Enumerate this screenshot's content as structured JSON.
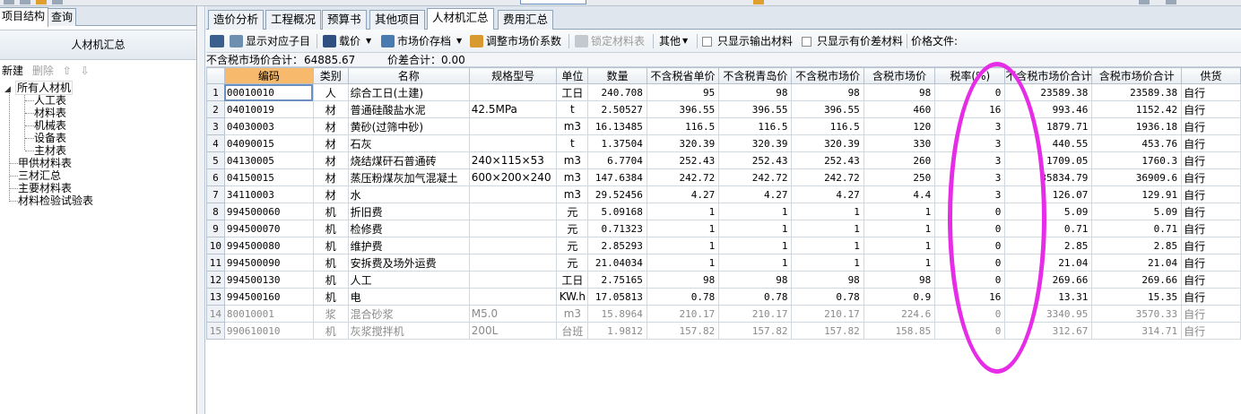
{
  "left": {
    "tabs": [
      "项目结构",
      "查询"
    ],
    "header": "人材机汇总",
    "toolbar": {
      "new": "新建",
      "delete": "删除",
      "up": "⇧",
      "down": "⇩"
    },
    "tree": {
      "root": "所有人材机",
      "children": [
        "人工表",
        "材料表",
        "机械表",
        "设备表",
        "主材表"
      ],
      "others": [
        "甲供材料表",
        "三材汇总",
        "主要材料表",
        "材料检验试验表"
      ]
    }
  },
  "main": {
    "tabs": [
      "造价分析",
      "工程概况",
      "预算书",
      "其他项目",
      "人材机汇总",
      "费用汇总"
    ],
    "active_tab": "人材机汇总",
    "toolbar": {
      "show_sub": "显示对应子目",
      "price_load": "载价",
      "market_archive": "市场价存档",
      "adjust_coeff": "调整市场价系数",
      "lock": "锁定材料表",
      "other": "其他",
      "only_output": "只显示输出材料",
      "only_diff": "只显示有价差材料",
      "price_file": "价格文件:"
    },
    "summary": {
      "total_label": "不含税市场价合计：",
      "total_value": "64885.67",
      "diff_label": "价差合计：",
      "diff_value": "0.00"
    }
  },
  "table": {
    "headers": [
      "编码",
      "类别",
      "名称",
      "规格型号",
      "单位",
      "数量",
      "不含税省单价",
      "不含税青岛价",
      "不含税市场价",
      "含税市场价",
      "税率(%)",
      "不含税市场价合计",
      "含税市场价合计",
      "供货"
    ],
    "rows": [
      {
        "n": "1",
        "code": "00010010",
        "cat": "人",
        "name": "综合工日(土建)",
        "spec": "",
        "unit": "工日",
        "qty": "240.708",
        "p1": "95",
        "p2": "98",
        "p3": "98",
        "p4": "98",
        "tax": "0",
        "t1": "23589.38",
        "t2": "23589.38",
        "sup": "自行",
        "grey": false
      },
      {
        "n": "2",
        "code": "04010019",
        "cat": "材",
        "name": "普通硅酸盐水泥",
        "spec": "42.5MPa",
        "unit": "t",
        "qty": "2.50527",
        "p1": "396.55",
        "p2": "396.55",
        "p3": "396.55",
        "p4": "460",
        "tax": "16",
        "t1": "993.46",
        "t2": "1152.42",
        "sup": "自行",
        "grey": false
      },
      {
        "n": "3",
        "code": "04030003",
        "cat": "材",
        "name": "黄砂(过筛中砂)",
        "spec": "",
        "unit": "m3",
        "qty": "16.13485",
        "p1": "116.5",
        "p2": "116.5",
        "p3": "116.5",
        "p4": "120",
        "tax": "3",
        "t1": "1879.71",
        "t2": "1936.18",
        "sup": "自行",
        "grey": false
      },
      {
        "n": "4",
        "code": "04090015",
        "cat": "材",
        "name": "石灰",
        "spec": "",
        "unit": "t",
        "qty": "1.37504",
        "p1": "320.39",
        "p2": "320.39",
        "p3": "320.39",
        "p4": "330",
        "tax": "3",
        "t1": "440.55",
        "t2": "453.76",
        "sup": "自行",
        "grey": false
      },
      {
        "n": "5",
        "code": "04130005",
        "cat": "材",
        "name": "烧结煤矸石普通砖",
        "spec": "240×115×53",
        "unit": "m3",
        "qty": "6.7704",
        "p1": "252.43",
        "p2": "252.43",
        "p3": "252.43",
        "p4": "260",
        "tax": "3",
        "t1": "1709.05",
        "t2": "1760.3",
        "sup": "自行",
        "grey": false
      },
      {
        "n": "6",
        "code": "04150015",
        "cat": "材",
        "name": "蒸压粉煤灰加气混凝土",
        "spec": "600×200×240",
        "unit": "m3",
        "qty": "147.6384",
        "p1": "242.72",
        "p2": "242.72",
        "p3": "242.72",
        "p4": "250",
        "tax": "3",
        "t1": "35834.79",
        "t2": "36909.6",
        "sup": "自行",
        "grey": false
      },
      {
        "n": "7",
        "code": "34110003",
        "cat": "材",
        "name": "水",
        "spec": "",
        "unit": "m3",
        "qty": "29.52456",
        "p1": "4.27",
        "p2": "4.27",
        "p3": "4.27",
        "p4": "4.4",
        "tax": "3",
        "t1": "126.07",
        "t2": "129.91",
        "sup": "自行",
        "grey": false
      },
      {
        "n": "8",
        "code": "994500060",
        "cat": "机",
        "name": "折旧费",
        "spec": "",
        "unit": "元",
        "qty": "5.09168",
        "p1": "1",
        "p2": "1",
        "p3": "1",
        "p4": "1",
        "tax": "0",
        "t1": "5.09",
        "t2": "5.09",
        "sup": "自行",
        "grey": false
      },
      {
        "n": "9",
        "code": "994500070",
        "cat": "机",
        "name": "检修费",
        "spec": "",
        "unit": "元",
        "qty": "0.71323",
        "p1": "1",
        "p2": "1",
        "p3": "1",
        "p4": "1",
        "tax": "0",
        "t1": "0.71",
        "t2": "0.71",
        "sup": "自行",
        "grey": false
      },
      {
        "n": "10",
        "code": "994500080",
        "cat": "机",
        "name": "维护费",
        "spec": "",
        "unit": "元",
        "qty": "2.85293",
        "p1": "1",
        "p2": "1",
        "p3": "1",
        "p4": "1",
        "tax": "0",
        "t1": "2.85",
        "t2": "2.85",
        "sup": "自行",
        "grey": false
      },
      {
        "n": "11",
        "code": "994500090",
        "cat": "机",
        "name": "安拆费及场外运费",
        "spec": "",
        "unit": "元",
        "qty": "21.04034",
        "p1": "1",
        "p2": "1",
        "p3": "1",
        "p4": "1",
        "tax": "0",
        "t1": "21.04",
        "t2": "21.04",
        "sup": "自行",
        "grey": false
      },
      {
        "n": "12",
        "code": "994500130",
        "cat": "机",
        "name": "人工",
        "spec": "",
        "unit": "工日",
        "qty": "2.75165",
        "p1": "98",
        "p2": "98",
        "p3": "98",
        "p4": "98",
        "tax": "0",
        "t1": "269.66",
        "t2": "269.66",
        "sup": "自行",
        "grey": false
      },
      {
        "n": "13",
        "code": "994500160",
        "cat": "机",
        "name": "电",
        "spec": "",
        "unit": "KW.h",
        "qty": "17.05813",
        "p1": "0.78",
        "p2": "0.78",
        "p3": "0.78",
        "p4": "0.9",
        "tax": "16",
        "t1": "13.31",
        "t2": "15.35",
        "sup": "自行",
        "grey": false
      },
      {
        "n": "14",
        "code": "80010001",
        "cat": "浆",
        "name": "混合砂浆",
        "spec": "M5.0",
        "unit": "m3",
        "qty": "15.8964",
        "p1": "210.17",
        "p2": "210.17",
        "p3": "210.17",
        "p4": "224.6",
        "tax": "0",
        "t1": "3340.95",
        "t2": "3570.33",
        "sup": "自行",
        "grey": true
      },
      {
        "n": "15",
        "code": "990610010",
        "cat": "机",
        "name": "灰浆搅拌机",
        "spec": "200L",
        "unit": "台班",
        "qty": "1.9812",
        "p1": "157.82",
        "p2": "157.82",
        "p3": "157.82",
        "p4": "158.85",
        "tax": "0",
        "t1": "312.67",
        "t2": "314.71",
        "sup": "自行",
        "grey": true
      }
    ]
  },
  "colors": {
    "highlight_header": "#f7b96b",
    "annotation": "#e62ce6",
    "grey_text": "#8a8a8a"
  }
}
